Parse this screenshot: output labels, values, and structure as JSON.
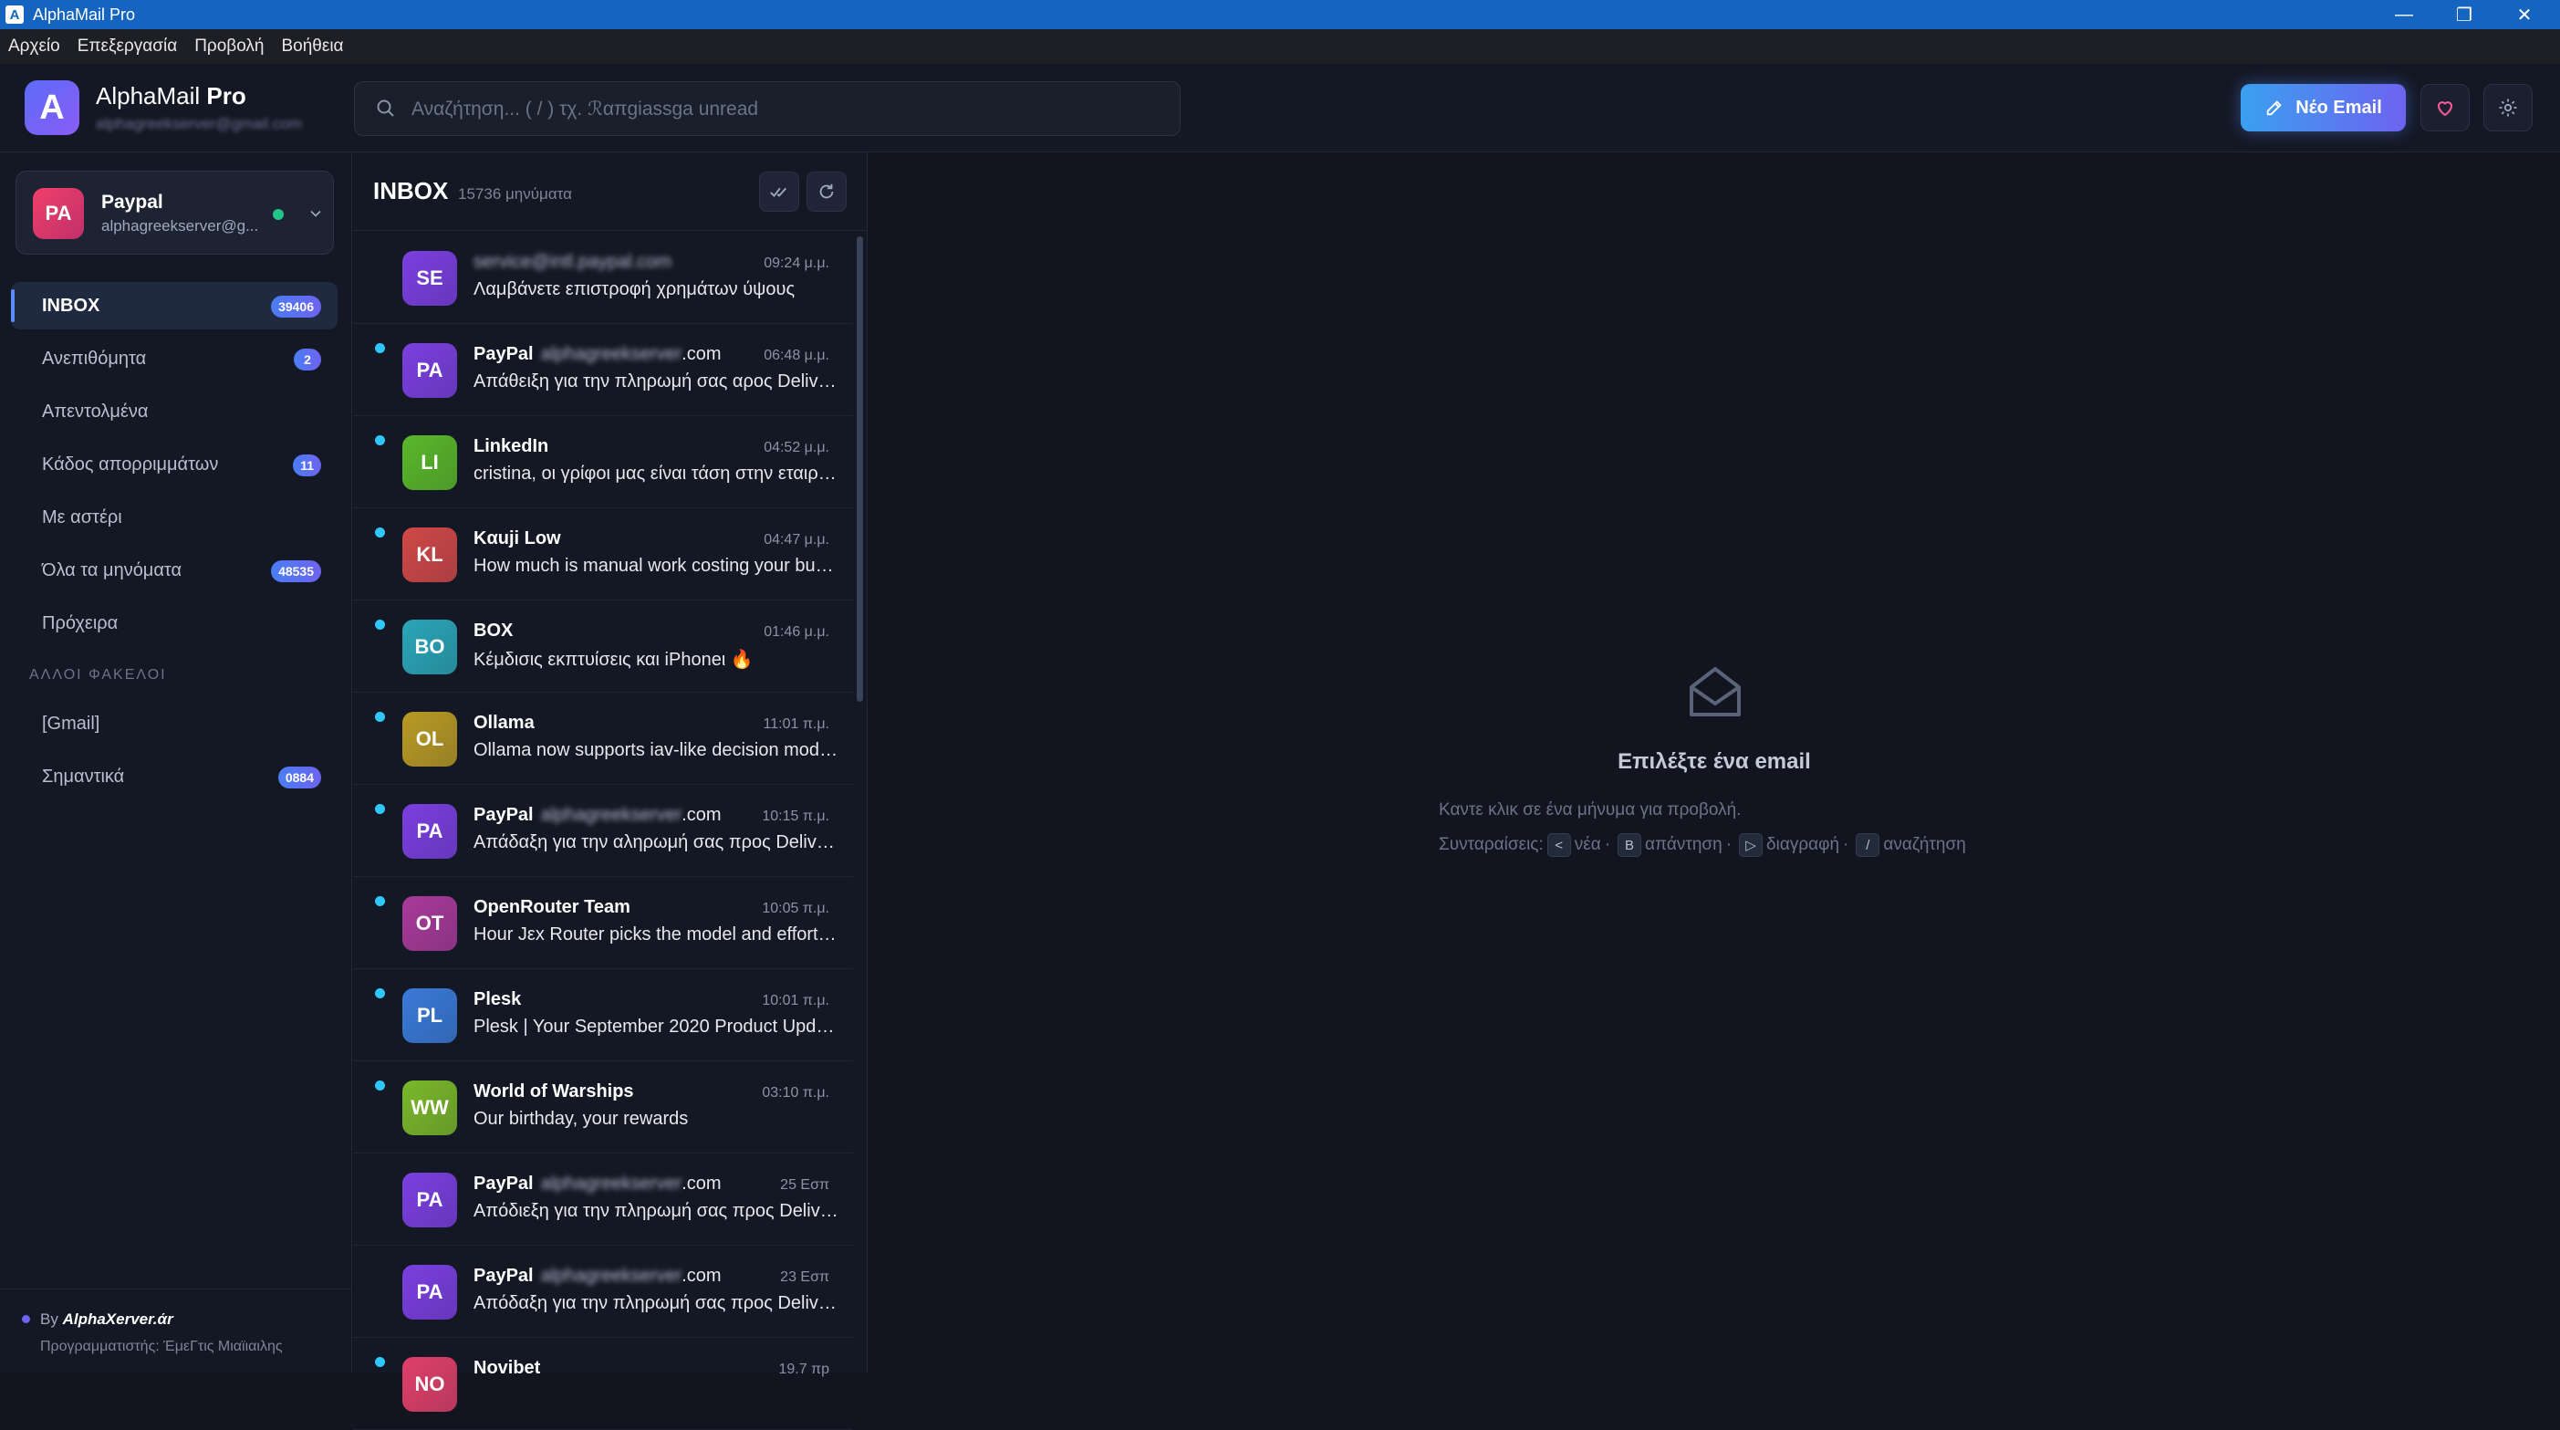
{
  "window": {
    "title": "AlphaMail Pro"
  },
  "menu": [
    "Αρχείο",
    "Επεξεργασία",
    "Προβολή",
    "Βοήθεια"
  ],
  "header": {
    "brand_main": "AlphaMail",
    "brand_bold": "Pro",
    "brand_email": "alphagreekserver@gmail.com",
    "search_placeholder": "Αναζήτηση... ( / )  τχ.  ℛαπgiassga  unread",
    "new_email_label": "Νέο Email",
    "accent": "#4a7ef5"
  },
  "account": {
    "initials": "PA",
    "name": "Paypal",
    "email": "alphagreekserver@g...",
    "status_color": "#22c58a"
  },
  "folders": [
    {
      "label": "INBOX",
      "badge": "39406",
      "active": true
    },
    {
      "label": "Ανεπιθόμητα",
      "badge": "2"
    },
    {
      "label": "Απεντολμένα",
      "badge": ""
    },
    {
      "label": "Κάδος απορριμμάτων",
      "badge": "11"
    },
    {
      "label": "Με αστέρι",
      "badge": ""
    },
    {
      "label": "Όλα τα μηνόματα",
      "badge": "48535"
    },
    {
      "label": "Πρόχειρα",
      "badge": ""
    }
  ],
  "other_folders_heading": "ΑΛΛΟΙ ΦΑΚΕΛΟΙ",
  "other_folders": [
    {
      "label": "[Gmail]",
      "badge": ""
    },
    {
      "label": "Σημαντικά",
      "badge": "0884"
    }
  ],
  "footer": {
    "by": "By",
    "by_name": "AlphaΧerver.άr",
    "developer": "Προγραμματιστής: ΈμεΓτις Μιαϊιαιλης"
  },
  "list": {
    "title": "INBOX",
    "count": "15736 μηνύματα",
    "messages": [
      {
        "initials": "SE",
        "from": "",
        "from_blur": "service@intl.paypal.com",
        "from_domain": "",
        "time": "09:24 μ.μ.",
        "subject": "Λαμβάνετε επιστροφή χρημάτων ύψους",
        "unread": false,
        "color": "#7b3fe0"
      },
      {
        "initials": "PA",
        "from": "PayPal",
        "from_blur": "alphagreekserver",
        "from_domain": ".com",
        "time": "06:48 μ.μ.",
        "subject": "Απάθειξη για την πληρωμή σας αρος Delivero",
        "unread": true,
        "color": "#7b3fe0"
      },
      {
        "initials": "LI",
        "from": "LinkedIn",
        "from_blur": "",
        "from_domain": "",
        "time": "04:52 μ.μ.",
        "subject": "cristina, οι γρίφοι μας είναι τάση στην εταιρεία",
        "unread": true,
        "color": "#5ab82a"
      },
      {
        "initials": "KL",
        "from": "Kαuji Low",
        "from_blur": "",
        "from_domain": "",
        "time": "04:47 μ.μ.",
        "subject": "How much is manual work costing your business",
        "unread": true,
        "color": "#d04848"
      },
      {
        "initials": "BO",
        "from": "BOX",
        "from_blur": "",
        "from_domain": "",
        "time": "01:46 μ.μ.",
        "subject": "Κέμδισις εκπτυίσεις και iPhoneι 🔥",
        "unread": true,
        "color": "#2aa6b8"
      },
      {
        "initials": "OL",
        "from": "Ollama",
        "from_blur": "",
        "from_domain": "",
        "time": "11:01 π.μ.",
        "subject": "Ollama now supports iav-like decision models",
        "unread": true,
        "color": "#b89a24"
      },
      {
        "initials": "PA",
        "from": "PayPal",
        "from_blur": "alphagreekserver",
        "from_domain": ".com",
        "time": "10:15 π.μ.",
        "subject": "Απάδαξη για την αληρωμή σας προς Delivero",
        "unread": true,
        "color": "#7b3fe0"
      },
      {
        "initials": "OT",
        "from": "OpenRouter Team",
        "from_blur": "",
        "from_domain": "",
        "time": "10:05 π.μ.",
        "subject": "Hour Jεx Router picks the model and effort for you",
        "unread": true,
        "color": "#a83a9a"
      },
      {
        "initials": "PL",
        "from": "Plesk",
        "from_blur": "",
        "from_domain": "",
        "time": "10:01 π.μ.",
        "subject": "Plesk | Your September 2020 Product Updates",
        "unread": true,
        "color": "#3a7ad8"
      },
      {
        "initials": "WW",
        "from": "World of Warships",
        "from_blur": "",
        "from_domain": "",
        "time": "03:10 π.μ.",
        "subject": "Our birthday, your rewards",
        "unread": true,
        "color": "#7ab82a"
      },
      {
        "initials": "PA",
        "from": "PayPal",
        "from_blur": "alphagreekserver",
        "from_domain": ".com",
        "time": "25 Εσπ",
        "subject": "Απόδιεξη για την πληρωμή σας προς Delivero",
        "unread": false,
        "color": "#7b3fe0"
      },
      {
        "initials": "PA",
        "from": "PayPal",
        "from_blur": "alphagreekserver",
        "from_domain": ".com",
        "time": "23 Εσπ",
        "subject": "Απόδαξη για την πληρωμή σας προς Delivero",
        "unread": false,
        "color": "#7b3fe0"
      },
      {
        "initials": "NO",
        "from": "Novibet",
        "from_blur": "",
        "from_domain": "",
        "time": "19.7 πp",
        "subject": "",
        "unread": true,
        "color": "#e0406a"
      }
    ]
  },
  "preview": {
    "title": "Επιλέξτε ένα email",
    "hint": "Καντε κλικ σε ένα μήνυμα για προβολή.",
    "shortcuts_label": "Συνταραίσεις:",
    "shortcuts": [
      {
        "key": "<",
        "label": "νέα"
      },
      {
        "key": "B",
        "label": "απάντηση"
      },
      {
        "key": "▷",
        "label": "διαγραφή"
      },
      {
        "key": "/",
        "label": "αναζήτηση"
      }
    ]
  }
}
